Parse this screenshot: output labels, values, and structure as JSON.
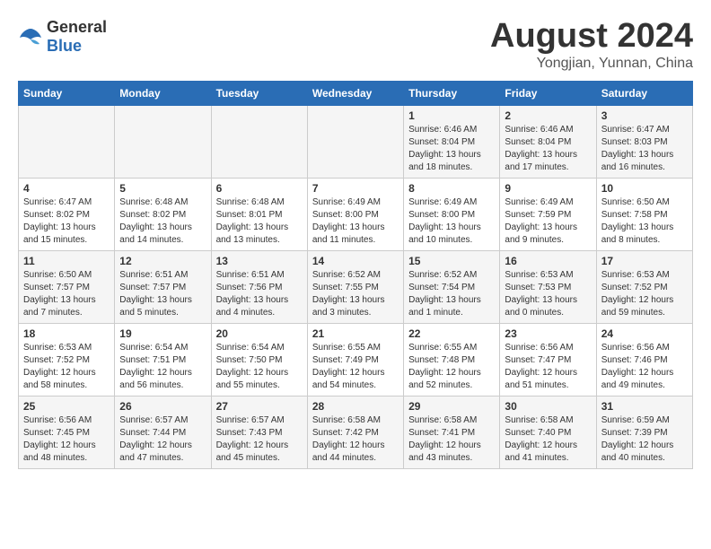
{
  "header": {
    "logo_general": "General",
    "logo_blue": "Blue",
    "month": "August 2024",
    "location": "Yongjian, Yunnan, China"
  },
  "weekdays": [
    "Sunday",
    "Monday",
    "Tuesday",
    "Wednesday",
    "Thursday",
    "Friday",
    "Saturday"
  ],
  "weeks": [
    [
      {
        "day": "",
        "info": ""
      },
      {
        "day": "",
        "info": ""
      },
      {
        "day": "",
        "info": ""
      },
      {
        "day": "",
        "info": ""
      },
      {
        "day": "1",
        "info": "Sunrise: 6:46 AM\nSunset: 8:04 PM\nDaylight: 13 hours and 18 minutes."
      },
      {
        "day": "2",
        "info": "Sunrise: 6:46 AM\nSunset: 8:04 PM\nDaylight: 13 hours and 17 minutes."
      },
      {
        "day": "3",
        "info": "Sunrise: 6:47 AM\nSunset: 8:03 PM\nDaylight: 13 hours and 16 minutes."
      }
    ],
    [
      {
        "day": "4",
        "info": "Sunrise: 6:47 AM\nSunset: 8:02 PM\nDaylight: 13 hours and 15 minutes."
      },
      {
        "day": "5",
        "info": "Sunrise: 6:48 AM\nSunset: 8:02 PM\nDaylight: 13 hours and 14 minutes."
      },
      {
        "day": "6",
        "info": "Sunrise: 6:48 AM\nSunset: 8:01 PM\nDaylight: 13 hours and 13 minutes."
      },
      {
        "day": "7",
        "info": "Sunrise: 6:49 AM\nSunset: 8:00 PM\nDaylight: 13 hours and 11 minutes."
      },
      {
        "day": "8",
        "info": "Sunrise: 6:49 AM\nSunset: 8:00 PM\nDaylight: 13 hours and 10 minutes."
      },
      {
        "day": "9",
        "info": "Sunrise: 6:49 AM\nSunset: 7:59 PM\nDaylight: 13 hours and 9 minutes."
      },
      {
        "day": "10",
        "info": "Sunrise: 6:50 AM\nSunset: 7:58 PM\nDaylight: 13 hours and 8 minutes."
      }
    ],
    [
      {
        "day": "11",
        "info": "Sunrise: 6:50 AM\nSunset: 7:57 PM\nDaylight: 13 hours and 7 minutes."
      },
      {
        "day": "12",
        "info": "Sunrise: 6:51 AM\nSunset: 7:57 PM\nDaylight: 13 hours and 5 minutes."
      },
      {
        "day": "13",
        "info": "Sunrise: 6:51 AM\nSunset: 7:56 PM\nDaylight: 13 hours and 4 minutes."
      },
      {
        "day": "14",
        "info": "Sunrise: 6:52 AM\nSunset: 7:55 PM\nDaylight: 13 hours and 3 minutes."
      },
      {
        "day": "15",
        "info": "Sunrise: 6:52 AM\nSunset: 7:54 PM\nDaylight: 13 hours and 1 minute."
      },
      {
        "day": "16",
        "info": "Sunrise: 6:53 AM\nSunset: 7:53 PM\nDaylight: 13 hours and 0 minutes."
      },
      {
        "day": "17",
        "info": "Sunrise: 6:53 AM\nSunset: 7:52 PM\nDaylight: 12 hours and 59 minutes."
      }
    ],
    [
      {
        "day": "18",
        "info": "Sunrise: 6:53 AM\nSunset: 7:52 PM\nDaylight: 12 hours and 58 minutes."
      },
      {
        "day": "19",
        "info": "Sunrise: 6:54 AM\nSunset: 7:51 PM\nDaylight: 12 hours and 56 minutes."
      },
      {
        "day": "20",
        "info": "Sunrise: 6:54 AM\nSunset: 7:50 PM\nDaylight: 12 hours and 55 minutes."
      },
      {
        "day": "21",
        "info": "Sunrise: 6:55 AM\nSunset: 7:49 PM\nDaylight: 12 hours and 54 minutes."
      },
      {
        "day": "22",
        "info": "Sunrise: 6:55 AM\nSunset: 7:48 PM\nDaylight: 12 hours and 52 minutes."
      },
      {
        "day": "23",
        "info": "Sunrise: 6:56 AM\nSunset: 7:47 PM\nDaylight: 12 hours and 51 minutes."
      },
      {
        "day": "24",
        "info": "Sunrise: 6:56 AM\nSunset: 7:46 PM\nDaylight: 12 hours and 49 minutes."
      }
    ],
    [
      {
        "day": "25",
        "info": "Sunrise: 6:56 AM\nSunset: 7:45 PM\nDaylight: 12 hours and 48 minutes."
      },
      {
        "day": "26",
        "info": "Sunrise: 6:57 AM\nSunset: 7:44 PM\nDaylight: 12 hours and 47 minutes."
      },
      {
        "day": "27",
        "info": "Sunrise: 6:57 AM\nSunset: 7:43 PM\nDaylight: 12 hours and 45 minutes."
      },
      {
        "day": "28",
        "info": "Sunrise: 6:58 AM\nSunset: 7:42 PM\nDaylight: 12 hours and 44 minutes."
      },
      {
        "day": "29",
        "info": "Sunrise: 6:58 AM\nSunset: 7:41 PM\nDaylight: 12 hours and 43 minutes."
      },
      {
        "day": "30",
        "info": "Sunrise: 6:58 AM\nSunset: 7:40 PM\nDaylight: 12 hours and 41 minutes."
      },
      {
        "day": "31",
        "info": "Sunrise: 6:59 AM\nSunset: 7:39 PM\nDaylight: 12 hours and 40 minutes."
      }
    ]
  ]
}
